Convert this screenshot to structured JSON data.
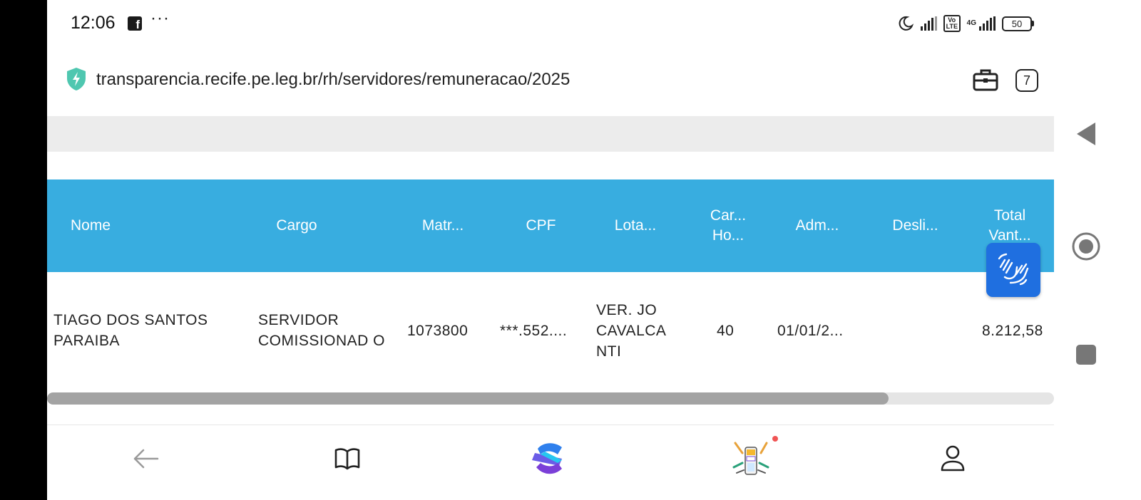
{
  "status_bar": {
    "time": "12:06",
    "fb_glyph": "f",
    "more_glyph": "···",
    "volte": "Vo LTE",
    "network": "4G",
    "battery": "50"
  },
  "browser": {
    "url": "transparencia.recife.pe.leg.br/rh/servidores/remuneracao/2025",
    "tab_count": "7"
  },
  "table": {
    "headers": {
      "nome": "Nome",
      "cargo": "Cargo",
      "matricula": "Matr...",
      "cpf": "CPF",
      "lotacao": "Lota...",
      "carga_horaria": "Car... Ho...",
      "admissao": "Adm...",
      "desligamento": "Desli...",
      "total_vantagens": "Total Vant..."
    },
    "row": {
      "nome": "TIAGO DOS SANTOS PARAIBA",
      "cargo": "SERVIDOR COMISSIONAD O",
      "matricula": "1073800",
      "cpf": "***.552....",
      "lotacao": "VER. JO CAVALCA NTI",
      "carga_horaria": "40",
      "admissao": "01/01/2...",
      "desligamento": "",
      "total_vantagens": "8.212,58"
    }
  },
  "scroll": {
    "horizontal_position": 0.84
  },
  "bottom_nav": {
    "items": [
      "back-arrow-icon",
      "book-icon",
      "app-logo-icon",
      "games-icon",
      "profile-icon"
    ],
    "notification_dot": true
  },
  "colors": {
    "table_header": "#38ade0",
    "accessibility_button": "#1f6fe0",
    "notification_dot": "#f05454",
    "shield": "#4fc7b0"
  }
}
